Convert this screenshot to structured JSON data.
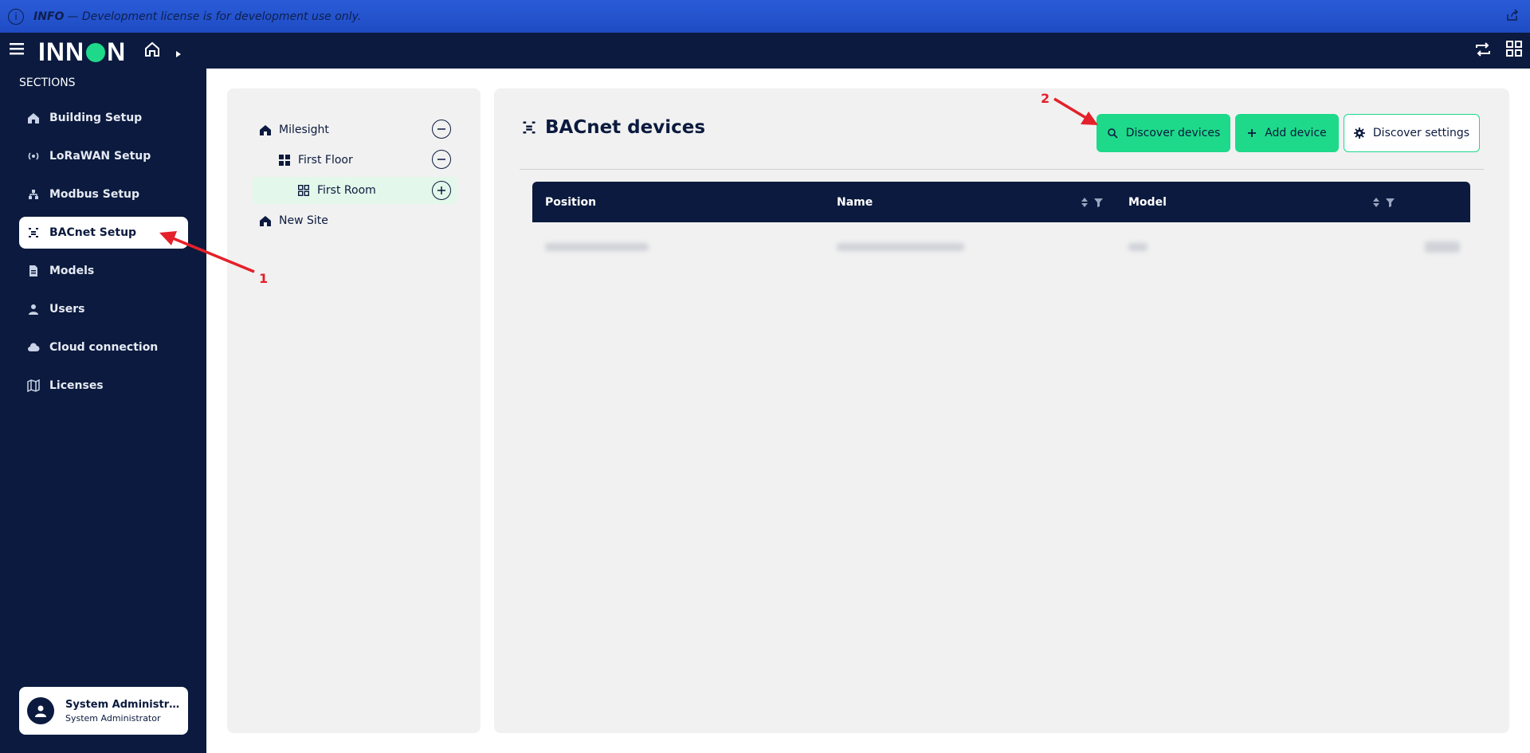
{
  "banner": {
    "label": "INFO",
    "message": "— Development license is for development use only."
  },
  "brand": {
    "logo_before": "INN",
    "logo_after": "N"
  },
  "sidebar": {
    "title": "SECTIONS",
    "items": [
      {
        "label": "Building Setup",
        "icon": "home-icon"
      },
      {
        "label": "LoRaWAN Setup",
        "icon": "signal-icon"
      },
      {
        "label": "Modbus Setup",
        "icon": "network-icon"
      },
      {
        "label": "BACnet Setup",
        "icon": "bacnet-icon",
        "active": true
      },
      {
        "label": "Models",
        "icon": "document-icon"
      },
      {
        "label": "Users",
        "icon": "user-icon"
      },
      {
        "label": "Cloud connection",
        "icon": "cloud-icon"
      },
      {
        "label": "Licenses",
        "icon": "map-icon"
      }
    ],
    "user": {
      "name": "System Administrator",
      "role": "System Administrator"
    }
  },
  "tree": {
    "nodes": [
      {
        "label": "Milesight",
        "level": 0,
        "icon": "home-icon",
        "action": "collapse"
      },
      {
        "label": "First Floor",
        "level": 1,
        "icon": "floor-icon",
        "action": "collapse"
      },
      {
        "label": "First Room",
        "level": 2,
        "icon": "room-icon",
        "action": "add",
        "selected": true
      },
      {
        "label": "New Site",
        "level": 0,
        "icon": "home-icon"
      }
    ]
  },
  "main": {
    "title": "BACnet devices",
    "buttons": {
      "discover": "Discover devices",
      "add": "Add device",
      "settings": "Discover settings"
    },
    "table": {
      "columns": [
        "Position",
        "Name",
        "Model"
      ]
    }
  },
  "annotations": {
    "one": "1",
    "two": "2"
  },
  "colors": {
    "navy": "#0b1a3e",
    "accent": "#1ed98a",
    "banner": "#2a5bd7",
    "annotation": "#e4202a"
  }
}
